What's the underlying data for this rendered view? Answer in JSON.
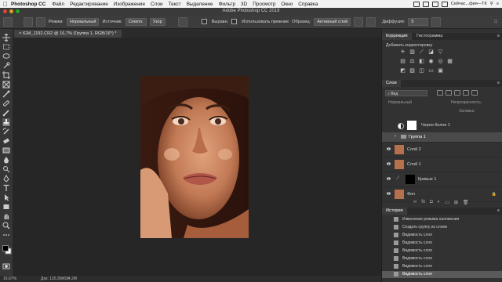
{
  "menubar": {
    "app": "Photoshop CC",
    "items": [
      "Файл",
      "Редактирование",
      "Изображение",
      "Слои",
      "Текст",
      "Выделение",
      "Фильтр",
      "3D",
      "Просмотр",
      "Окно",
      "Справка"
    ],
    "status_text": "Сейчас...фия—ТК"
  },
  "window": {
    "title": "Adobe Photoshop CC 2019"
  },
  "options_bar": {
    "mode_label": "Режим:",
    "mode_value": "Нормальный",
    "source_label": "Источник:",
    "source_sample": "Семпл.",
    "source_pattern": "Узор",
    "align_label": "Выравн.",
    "legacy_label": "Использовать прежние",
    "sample_label": "Образец:",
    "sample_value": "Активный слой",
    "diffusion_label": "Диффузия:",
    "diffusion_value": "5"
  },
  "document": {
    "tab_label": "IGM_1192.CR2 @ 16,7% (Группа 1, RGB/16*) *"
  },
  "status_bar": {
    "zoom": "16,67%",
    "doc_info": "Док: 120,3М/634,2М"
  },
  "adjustments_panel": {
    "tab_active": "Коррекция",
    "tab_other": "Гистограмма",
    "subtitle": "Добавить корректировку"
  },
  "layers_panel": {
    "tab": "Слои",
    "filter_value": "Вид",
    "blend_mode": "Нормальный",
    "opacity_label": "Непрозрачность:",
    "fill_label": "Заливка:",
    "layers": [
      {
        "name": "Черно-белое 1",
        "visible": false,
        "kind": "adjustment"
      },
      {
        "name": "Группа 1",
        "visible": false,
        "kind": "group"
      },
      {
        "name": "Слой 2",
        "visible": true,
        "kind": "pixel"
      },
      {
        "name": "Слой 1",
        "visible": true,
        "kind": "pixel"
      },
      {
        "name": "Кривые 1",
        "visible": true,
        "kind": "curves"
      },
      {
        "name": "Фон",
        "visible": true,
        "kind": "background"
      }
    ]
  },
  "history_panel": {
    "tab": "История",
    "items": [
      "Изменение режима наложения",
      "Создать группу из слоев",
      "Видимость слоя",
      "Видимость слоя",
      "Видимость слоя",
      "Видимость слоя",
      "Видимость слоя",
      "Видимость слоя"
    ]
  }
}
